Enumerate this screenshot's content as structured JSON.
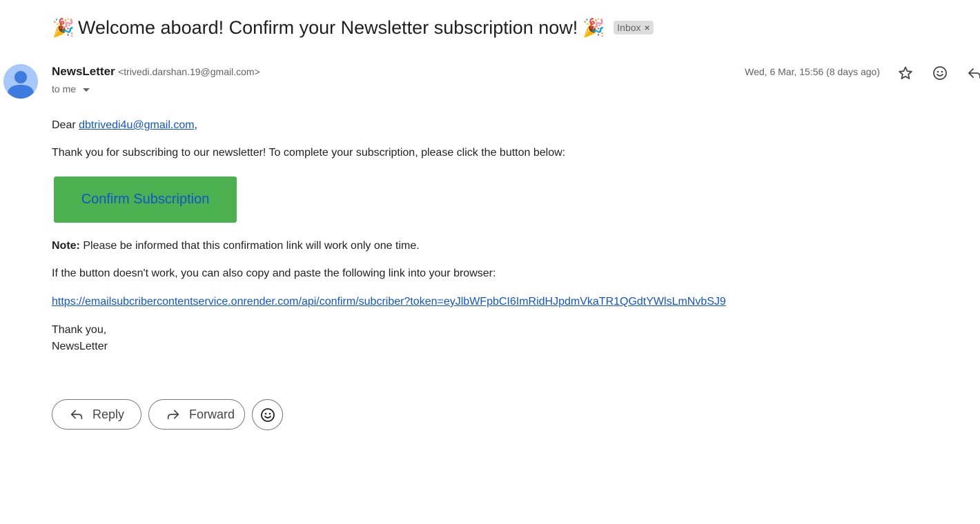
{
  "subject": {
    "text": "Welcome aboard! Confirm your Newsletter subscription now!",
    "emoji": "🎉",
    "label": "Inbox",
    "label_close": "×"
  },
  "sender": {
    "name": "NewsLetter",
    "email": "<trivedi.darshan.19@gmail.com>",
    "to": "to me",
    "date": "Wed, 6 Mar, 15:56 (8 days ago)"
  },
  "header_icons": [
    "star-icon",
    "emoji-icon",
    "reply-icon"
  ],
  "body": {
    "greeting_prefix": "Dear ",
    "greeting_email": "dbtrivedi4u@gmail.com",
    "greeting_suffix": ",",
    "intro": "Thank you for subscribing to our newsletter! To complete your subscription, please click the button below:",
    "button_label": "Confirm Subscription",
    "note_label": "Note:",
    "note_text": " Please be informed that this confirmation link will work only one time.",
    "fallback_text": "If the button doesn't work, you can also copy and paste the following link into your browser:",
    "link": "https://emailsubcribercontentservice.onrender.com/api/confirm/subcriber?token=eyJlbWFpbCI6ImRidHJpdmVkaTR1QGdtYWlsLmNvbSJ9",
    "signoff_1": "Thank you,",
    "signoff_2": "NewsLetter"
  },
  "actions": {
    "reply": "Reply",
    "forward": "Forward"
  },
  "colors": {
    "confirm_button_bg": "#4caf50",
    "link": "#1155cc",
    "avatar_bg": "#a8c7fa",
    "avatar_fg": "#3e7be0"
  }
}
